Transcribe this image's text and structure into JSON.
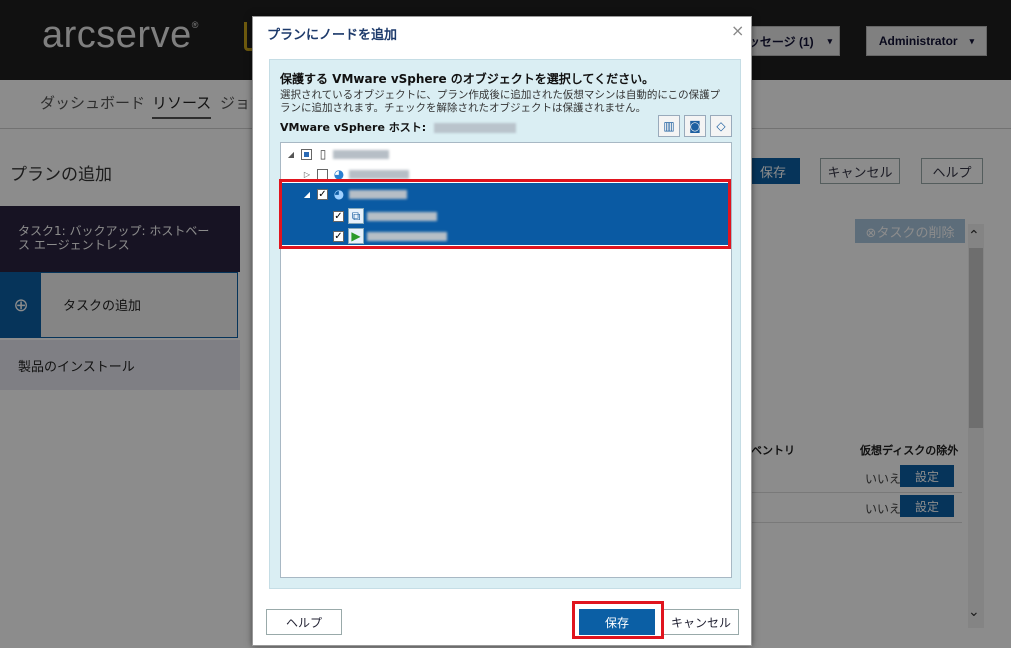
{
  "app": {
    "logo": "arcserve",
    "topbar": {
      "messages_label": "ッセージ (1)",
      "messages_caret": "▾",
      "user_label": "Administrator",
      "user_caret": "▾"
    },
    "nav": {
      "dashboard": "ダッシュボード",
      "resources": "リソース",
      "jobs": "ジョブ"
    },
    "page_title": "プランの追加",
    "toolbar": {
      "save": "保存",
      "cancel": "キャンセル",
      "help": "ヘルプ"
    },
    "left": {
      "task1": "タスク1: バックアップ: ホストベース エージェントレス",
      "add_task": "タスクの追加",
      "add_task_icon": "⊕",
      "install": "製品のインストール"
    },
    "delete_task": "⊗タスクの削除",
    "table": {
      "col_inventory": "ンベントリ",
      "col_exclude": "仮想ディスクの除外",
      "rows": [
        {
          "exclude": "いいえ",
          "action": "設定"
        },
        {
          "exclude": "いいえ",
          "action": "設定"
        }
      ]
    }
  },
  "dialog": {
    "title": "プランにノードを追加",
    "close": "×",
    "heading": "保護する VMware vSphere のオブジェクトを選択してください。",
    "description": "選択されているオブジェクトに、プラン作成後に追加された仮想マシンは自動的にこの保護プランに追加されます。チェックを解除されたオブジェクトは保護されません。",
    "host_label": "VMware vSphere ホスト:",
    "footer": {
      "help": "ヘルプ",
      "save": "保存",
      "cancel": "キャンセル"
    }
  },
  "colors": {
    "accent": "#0b5fa5",
    "highlight": "#e0141e",
    "dialog_panel": "#daeef3",
    "topbar": "#1f1f1f"
  }
}
